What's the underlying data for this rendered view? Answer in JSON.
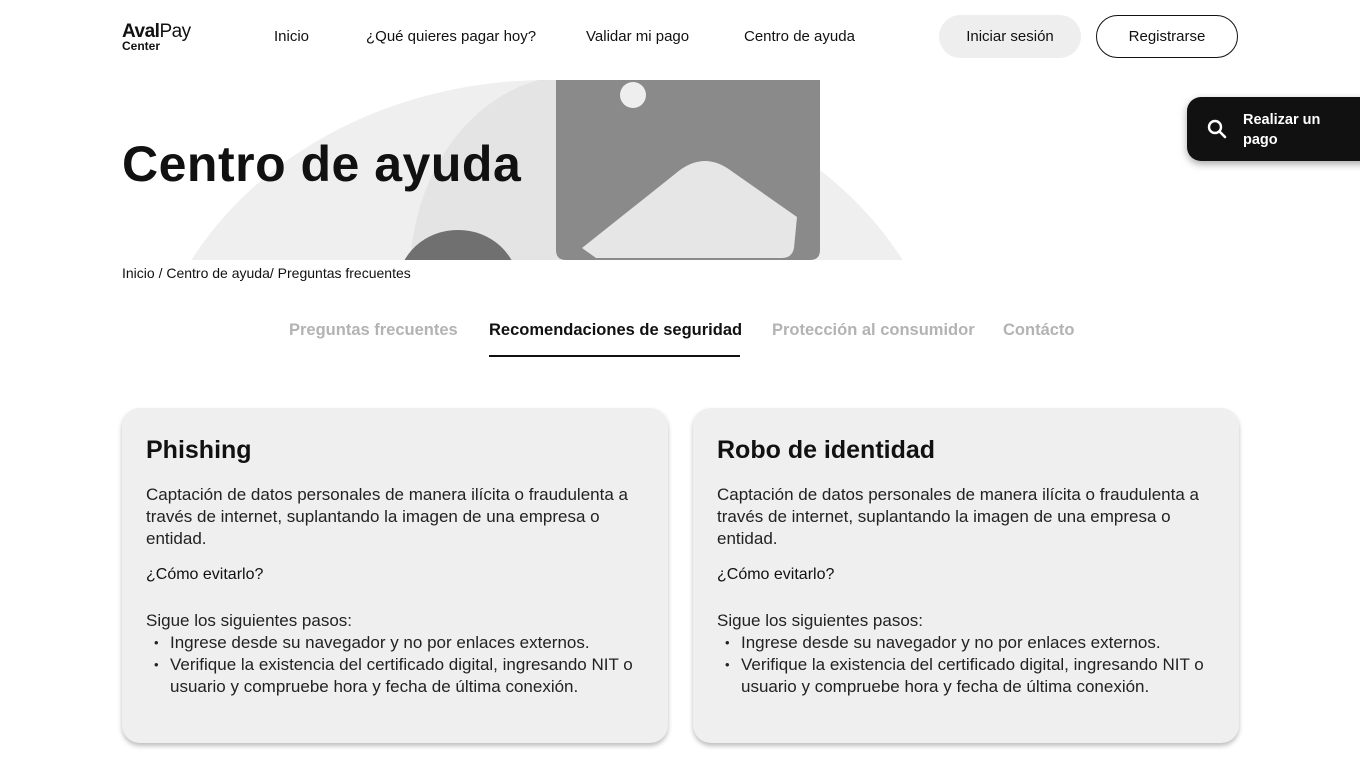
{
  "header": {
    "logo_line1_bold": "Aval",
    "logo_line1_light": "Pay",
    "logo_line2": "Center",
    "nav": [
      "Inicio",
      "¿Qué quieres pagar hoy?",
      "Validar mi pago",
      "Centro de ayuda"
    ],
    "login_label": "Iniciar sesión",
    "register_label": "Registrarse"
  },
  "hero": {
    "title": "Centro de ayuda",
    "image_icon": "image-placeholder-icon"
  },
  "fab": {
    "label": "Realizar un pago",
    "icon": "search-icon"
  },
  "breadcrumb": {
    "items": [
      "Inicio",
      "Centro de ayuda",
      "Preguntas frecuentes"
    ]
  },
  "tabs": [
    "Preguntas frecuentes",
    "Recomendaciones de seguridad",
    "Protección al consumidor",
    "Contácto"
  ],
  "active_tab": "Recomendaciones de seguridad",
  "cards": [
    {
      "title": "Phishing",
      "description": "Captación de datos personales de manera ilícita o fraudulenta a través de internet, suplantando la imagen de una empresa o entidad.",
      "how_title": "¿Cómo evitarlo?",
      "steps_intro": "Sigue los siguientes pasos:",
      "steps": [
        "Ingrese desde su navegador y no por enlaces externos.",
        "Verifique la existencia del certificado digital, ingresando NIT o usuario y compruebe hora y fecha de última conexión."
      ]
    },
    {
      "title": "Robo de identidad",
      "description": "Captación de datos personales de manera ilícita o fraudulenta a través de internet, suplantando la imagen de una empresa o entidad.",
      "how_title": "¿Cómo evitarlo?",
      "steps_intro": "Sigue los siguientes pasos:",
      "steps": [
        "Ingrese desde su navegador y no por enlaces externos.",
        "Verifique la existencia del certificado digital, ingresando NIT o usuario y compruebe hora y fecha de última conexión."
      ]
    }
  ],
  "colors": {
    "text": "#111111",
    "tab_inactive": "#b3b3b3",
    "card_bg": "#efefef",
    "fab_bg": "#111111",
    "login_bg": "#eeeeee"
  }
}
